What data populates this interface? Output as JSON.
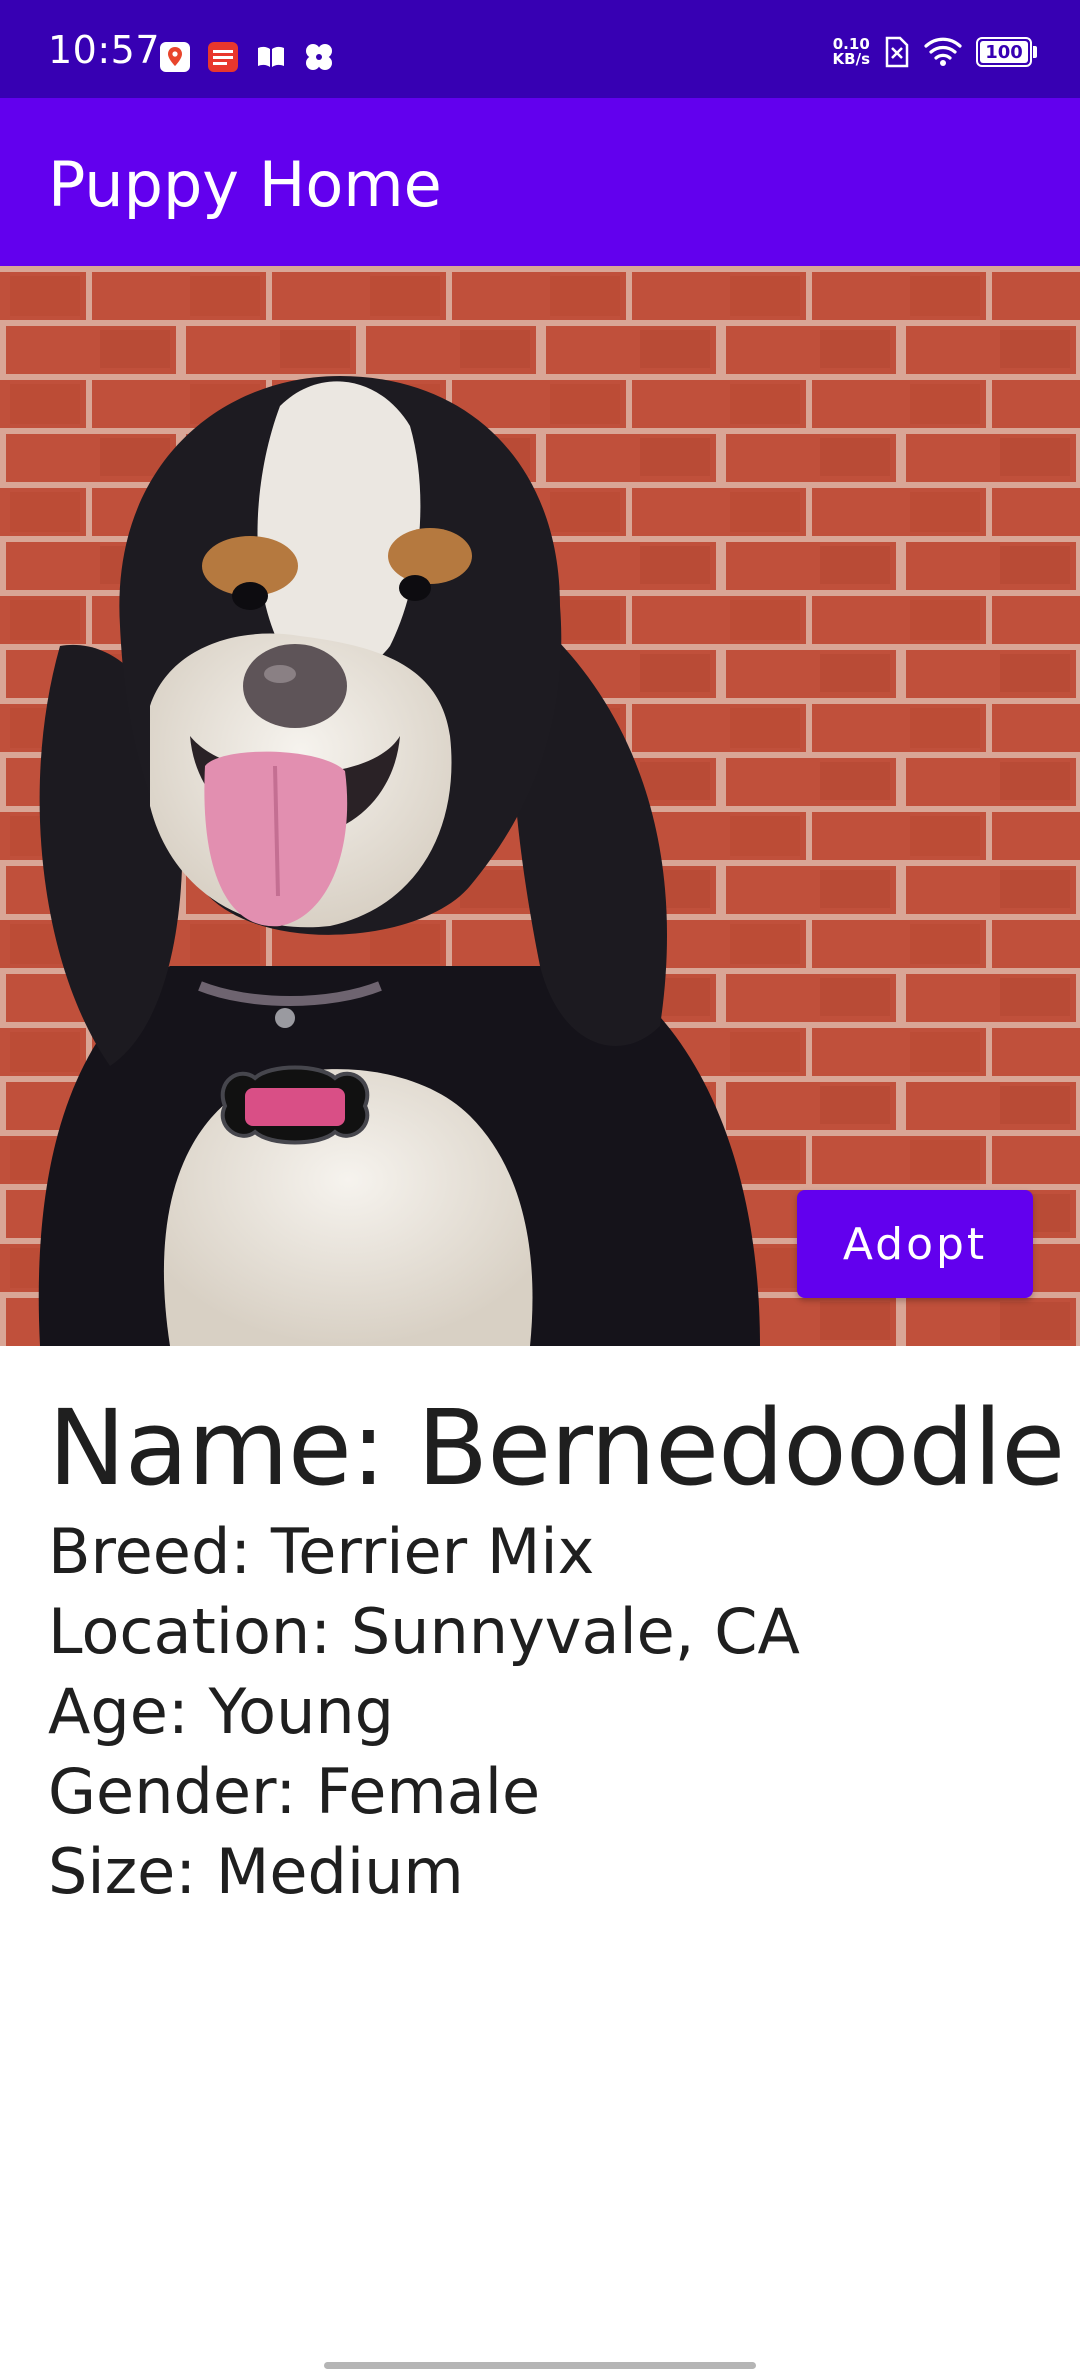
{
  "status_bar": {
    "time": "10:57",
    "net_speed_value": "0.10",
    "net_speed_unit": "KB/s",
    "battery_level": "100",
    "notification_icons": [
      "map-pin-app-icon",
      "toutiao-news-icon",
      "book-icon",
      "fan-app-icon"
    ]
  },
  "app_bar": {
    "title": "Puppy Home"
  },
  "photo": {
    "subject": "dog-photo"
  },
  "actions": {
    "adopt_label": "Adopt"
  },
  "pet": {
    "name_line": "Name: Bernedoodle",
    "breed_line": "Breed: Terrier Mix",
    "location_line": "Location: Sunnyvale, CA",
    "age_line": "Age: Young",
    "gender_line": "Gender: Female",
    "size_line": "Size: Medium"
  },
  "colors": {
    "status_bar": "#3700B3",
    "primary": "#6200EE",
    "text": "#1f1f1f"
  }
}
